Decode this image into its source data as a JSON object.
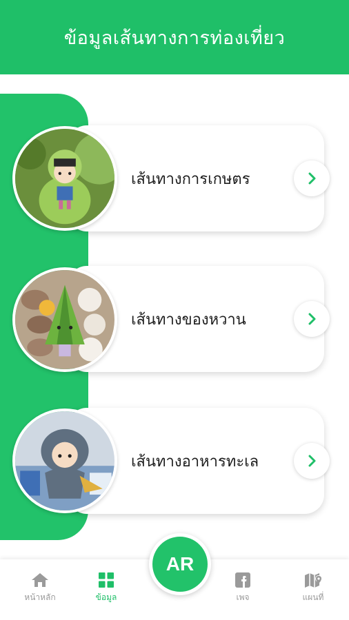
{
  "header": {
    "title": "ข้อมูลเส้นทางการท่องเที่ยว"
  },
  "routes": [
    {
      "label": "เส้นทางการเกษตร"
    },
    {
      "label": "เส้นทางของหวาน"
    },
    {
      "label": "เส้นทางอาหารทะเล"
    }
  ],
  "nav": {
    "home": "หน้าหลัก",
    "info": "ข้อมูล",
    "ar": "AR",
    "page": "เพจ",
    "map": "แผนที่"
  },
  "colors": {
    "brand": "#1fbf68",
    "inactive": "#9a9a9a"
  }
}
